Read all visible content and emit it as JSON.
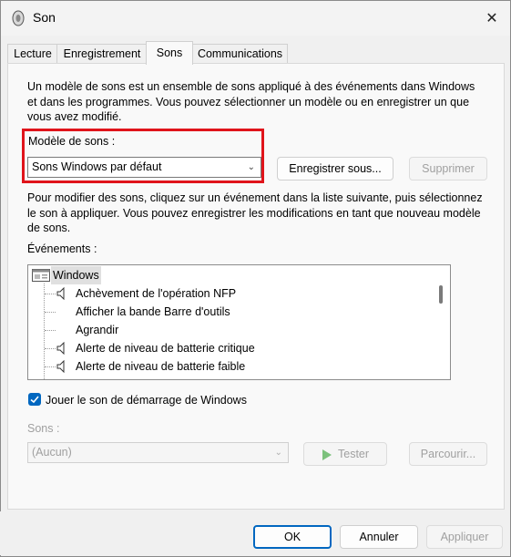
{
  "window": {
    "title": "Son"
  },
  "tabs": [
    {
      "label": "Lecture"
    },
    {
      "label": "Enregistrement"
    },
    {
      "label": "Sons"
    },
    {
      "label": "Communications"
    }
  ],
  "intro": "Un modèle de sons est un ensemble de sons appliqué à des événements dans Windows et dans les programmes. Vous pouvez sélectionner un modèle ou en enregistrer un que vous avez modifié.",
  "scheme": {
    "label": "Modèle de sons :",
    "selected": "Sons Windows par défaut",
    "save_button": "Enregistrer sous...",
    "delete_button": "Supprimer"
  },
  "instructions": "Pour modifier des sons, cliquez sur un événement dans la liste suivante, puis sélectionnez le son à appliquer. Vous pouvez enregistrer les modifications en tant que nouveau modèle de sons.",
  "events": {
    "label": "Événements :",
    "root": "Windows",
    "items": [
      {
        "label": "Achèvement de l'opération NFP",
        "icon": "speaker-icon"
      },
      {
        "label": "Afficher la bande Barre d'outils",
        "icon": ""
      },
      {
        "label": "Agrandir",
        "icon": ""
      },
      {
        "label": "Alerte de niveau de batterie critique",
        "icon": "speaker-icon"
      },
      {
        "label": "Alerte de niveau de batterie faible",
        "icon": "speaker-icon"
      }
    ]
  },
  "startup": {
    "label": "Jouer le son de démarrage de Windows",
    "checked": true
  },
  "sounds": {
    "label": "Sons :",
    "selected": "(Aucun)",
    "test_button": "Tester",
    "browse_button": "Parcourir..."
  },
  "footer": {
    "ok": "OK",
    "cancel": "Annuler",
    "apply": "Appliquer"
  },
  "colors": {
    "accent": "#0067c0",
    "highlight": "#e0141b"
  }
}
